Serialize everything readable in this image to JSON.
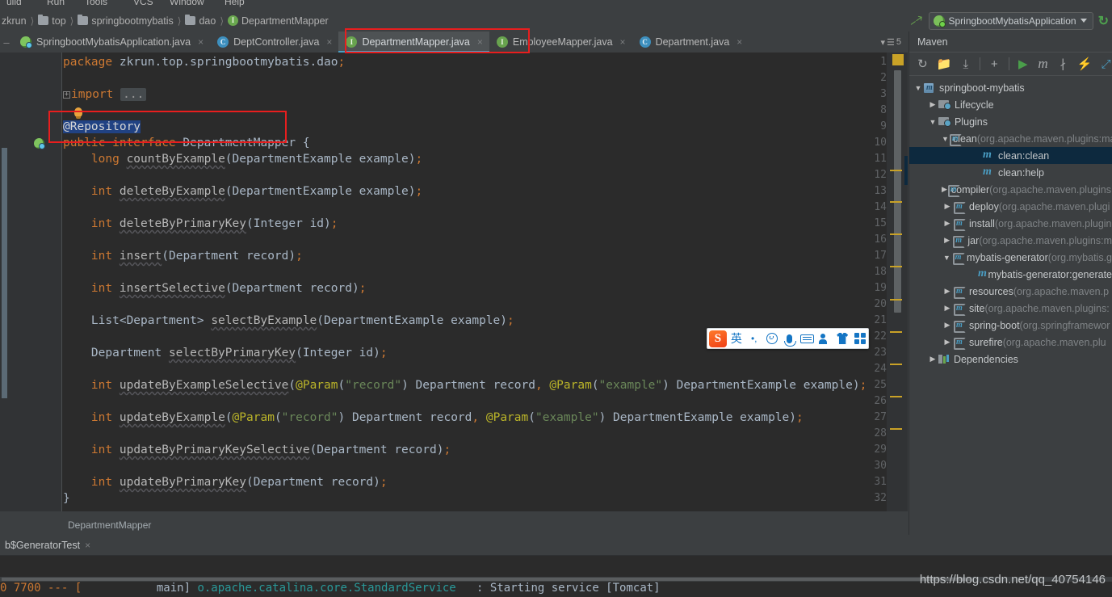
{
  "menu": {
    "items": [
      "uild",
      "Run",
      "Tools",
      "VCS",
      "Window",
      "Help"
    ]
  },
  "breadcrumb": {
    "items": [
      {
        "label": "zkrun",
        "icon": "none"
      },
      {
        "label": "top",
        "icon": "folder-icon"
      },
      {
        "label": "springbootmybatis",
        "icon": "folder-icon"
      },
      {
        "label": "dao",
        "icon": "folder-icon"
      },
      {
        "label": "DepartmentMapper",
        "icon": "interface-icon"
      }
    ]
  },
  "run_config": {
    "name": "SpringbootMybatisApplication",
    "back_arrow": "back-arrow-icon",
    "rerun": "rerun-icon"
  },
  "editor_tabs": {
    "items": [
      {
        "label": "SpringbootMybatisApplication.java",
        "icon": "spring-class-icon",
        "active": false
      },
      {
        "label": "DeptController.java",
        "icon": "class-icon",
        "active": false
      },
      {
        "label": "DepartmentMapper.java",
        "icon": "interface-icon",
        "active": true
      },
      {
        "label": "EmployeeMapper.java",
        "icon": "interface-icon",
        "active": false
      },
      {
        "label": "Department.java",
        "icon": "class-icon",
        "active": false
      }
    ],
    "overflow_count": "5",
    "close_glyph": "×"
  },
  "code": {
    "line_numbers": [
      "1",
      "2",
      "3",
      "8",
      "9",
      "10",
      "11",
      "12",
      "13",
      "14",
      "15",
      "16",
      "17",
      "18",
      "19",
      "20",
      "21",
      "22",
      "23",
      "24",
      "25",
      "26",
      "27",
      "28",
      "29",
      "30",
      "31",
      "32"
    ],
    "lines": [
      {
        "n": "1",
        "text": "package zkrun.top.springbootmybatis.dao;"
      },
      {
        "n": "2",
        "text": ""
      },
      {
        "n": "3",
        "text": "import ..."
      },
      {
        "n": "8",
        "text": ""
      },
      {
        "n": "9",
        "text": "@Repository"
      },
      {
        "n": "10",
        "text": "public interface DepartmentMapper {"
      },
      {
        "n": "11",
        "text": "    long countByExample(DepartmentExample example);"
      },
      {
        "n": "12",
        "text": ""
      },
      {
        "n": "13",
        "text": "    int deleteByExample(DepartmentExample example);"
      },
      {
        "n": "14",
        "text": ""
      },
      {
        "n": "15",
        "text": "    int deleteByPrimaryKey(Integer id);"
      },
      {
        "n": "16",
        "text": ""
      },
      {
        "n": "17",
        "text": "    int insert(Department record);"
      },
      {
        "n": "18",
        "text": ""
      },
      {
        "n": "19",
        "text": "    int insertSelective(Department record);"
      },
      {
        "n": "20",
        "text": ""
      },
      {
        "n": "21",
        "text": "    List<Department> selectByExample(DepartmentExample example);"
      },
      {
        "n": "22",
        "text": ""
      },
      {
        "n": "23",
        "text": "    Department selectByPrimaryKey(Integer id);"
      },
      {
        "n": "24",
        "text": ""
      },
      {
        "n": "25",
        "text": "    int updateByExampleSelective(@Param(\"record\") Department record, @Param(\"example\") DepartmentExample example);"
      },
      {
        "n": "26",
        "text": ""
      },
      {
        "n": "27",
        "text": "    int updateByExample(@Param(\"record\") Department record, @Param(\"example\") DepartmentExample example);"
      },
      {
        "n": "28",
        "text": ""
      },
      {
        "n": "29",
        "text": "    int updateByPrimaryKeySelective(Department record);"
      },
      {
        "n": "30",
        "text": ""
      },
      {
        "n": "31",
        "text": "    int updateByPrimaryKey(Department record);"
      },
      {
        "n": "32",
        "text": "}"
      }
    ],
    "fold_glyph": "+",
    "import_dots": "...",
    "selected_text": "@Repository"
  },
  "editor_status": {
    "breadcrumb": "DepartmentMapper"
  },
  "maven": {
    "title": "Maven",
    "toolbar": [
      {
        "name": "reimport-icon",
        "glyph": "↻"
      },
      {
        "name": "generate-sources-icon",
        "glyph": "◱"
      },
      {
        "name": "download-sources-icon",
        "glyph": "⤓"
      },
      {
        "name": "add-maven-project-icon",
        "glyph": "+"
      },
      {
        "name": "run-maven-build-icon",
        "glyph": "▶"
      },
      {
        "name": "execute-maven-goal-icon",
        "glyph": "m"
      },
      {
        "name": "toggle-skip-tests-icon",
        "glyph": "∦"
      },
      {
        "name": "toggle-offline-icon",
        "glyph": "⚡"
      },
      {
        "name": "expand-all-icon",
        "glyph": "⤢"
      }
    ],
    "tree": [
      {
        "depth": 0,
        "twisty": "▼",
        "icon": "maven-project-icon",
        "label": "springboot-mybatis",
        "dim": "",
        "selected": false
      },
      {
        "depth": 1,
        "twisty": "▶",
        "icon": "maven-folder-icon",
        "label": "Lifecycle",
        "dim": "",
        "selected": false
      },
      {
        "depth": 1,
        "twisty": "▼",
        "icon": "maven-folder-icon",
        "label": "Plugins",
        "dim": "",
        "selected": false
      },
      {
        "depth": 2,
        "twisty": "▼",
        "icon": "maven-plugin-icon",
        "label": "clean",
        "dim": "(org.apache.maven.plugins:maven-clean-plugin)",
        "selected": false
      },
      {
        "depth": 4,
        "twisty": "",
        "icon": "maven-goal-icon",
        "label": "clean:clean",
        "dim": "",
        "selected": true
      },
      {
        "depth": 4,
        "twisty": "",
        "icon": "maven-goal-icon",
        "label": "clean:help",
        "dim": "",
        "selected": false
      },
      {
        "depth": 2,
        "twisty": "▶",
        "icon": "maven-plugin-icon",
        "label": "compiler",
        "dim": "(org.apache.maven.plugins:",
        "selected": false
      },
      {
        "depth": 2,
        "twisty": "▶",
        "icon": "maven-plugin-icon",
        "label": "deploy",
        "dim": "(org.apache.maven.plugi",
        "selected": false
      },
      {
        "depth": 2,
        "twisty": "▶",
        "icon": "maven-plugin-icon",
        "label": "install",
        "dim": "(org.apache.maven.plugin",
        "selected": false
      },
      {
        "depth": 2,
        "twisty": "▶",
        "icon": "maven-plugin-icon",
        "label": "jar",
        "dim": "(org.apache.maven.plugins:m",
        "selected": false
      },
      {
        "depth": 2,
        "twisty": "▼",
        "icon": "maven-plugin-icon",
        "label": "mybatis-generator",
        "dim": "(org.mybatis.g",
        "selected": false
      },
      {
        "depth": 4,
        "twisty": "",
        "icon": "maven-goal-icon",
        "label": "mybatis-generator:generate",
        "dim": "",
        "selected": false
      },
      {
        "depth": 2,
        "twisty": "▶",
        "icon": "maven-plugin-icon",
        "label": "resources",
        "dim": "(org.apache.maven.p",
        "selected": false
      },
      {
        "depth": 2,
        "twisty": "▶",
        "icon": "maven-plugin-icon",
        "label": "site",
        "dim": "(org.apache.maven.plugins:",
        "selected": false
      },
      {
        "depth": 2,
        "twisty": "▶",
        "icon": "maven-plugin-icon",
        "label": "spring-boot",
        "dim": "(org.springframewor",
        "selected": false
      },
      {
        "depth": 2,
        "twisty": "▶",
        "icon": "maven-plugin-icon",
        "label": "surefire",
        "dim": "(org.apache.maven.plu",
        "selected": false
      },
      {
        "depth": 1,
        "twisty": "▶",
        "icon": "dependencies-icon",
        "label": "Dependencies",
        "dim": "",
        "selected": false
      }
    ]
  },
  "run_window": {
    "tab_label": "b$GeneratorTest",
    "close_glyph": "×",
    "console_line": {
      "prefix": "0 7700 --- [",
      "thread": "           main]",
      "logger": " o.apache.catalina.core.StandardService",
      "suffix": "   : Starting service [Tomcat]"
    }
  },
  "ime": {
    "logo": "sogou-logo-icon",
    "buttons": [
      {
        "name": "language-mode-button",
        "glyph": "英"
      },
      {
        "name": "punctuation-button",
        "glyph": "•,"
      },
      {
        "name": "emoji-button",
        "glyph": "smile"
      },
      {
        "name": "voice-input-button",
        "glyph": "mic"
      },
      {
        "name": "soft-keyboard-button",
        "glyph": "keyboard"
      },
      {
        "name": "user-center-button",
        "glyph": "person"
      },
      {
        "name": "skin-button",
        "glyph": "shirt"
      },
      {
        "name": "toolbox-button",
        "glyph": "grid"
      }
    ]
  },
  "watermark": {
    "text": "https://blog.csdn.net/qq_40754146"
  },
  "annotations": {
    "tab_highlight": "DepartmentMapper.java tab highlighted",
    "code_highlight": "@Repository / public interface DepartmentMapper highlighted"
  },
  "colors": {
    "accent_blue": "#4a9ec4",
    "annotation_red": "#e81e1e",
    "selection_blue": "#214283",
    "keyword_orange": "#cc7832",
    "string_green": "#6a8759",
    "annotation_yellow": "#bbb529"
  }
}
